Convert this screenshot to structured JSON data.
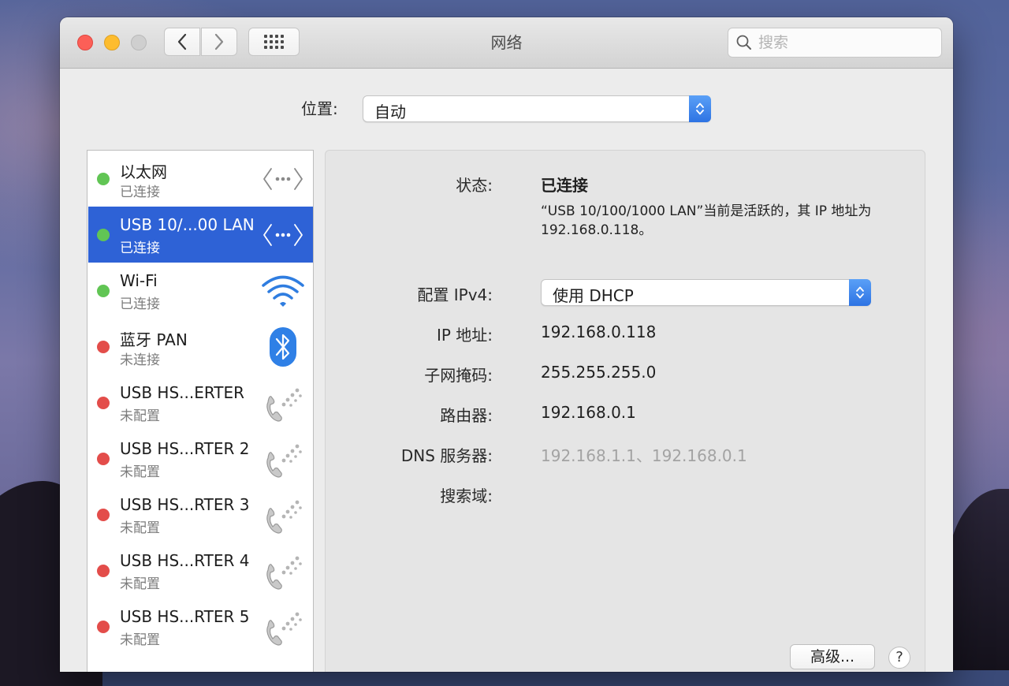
{
  "window": {
    "title": "网络"
  },
  "search": {
    "placeholder": "搜索"
  },
  "location": {
    "label": "位置:",
    "value": "自动"
  },
  "services": [
    {
      "name": "以太网",
      "status": "已连接",
      "state": "green",
      "icon": "ethernet-icon"
    },
    {
      "name": "USB 10/...00 LAN",
      "status": "已连接",
      "state": "green",
      "icon": "ethernet-icon"
    },
    {
      "name": "Wi-Fi",
      "status": "已连接",
      "state": "green",
      "icon": "wifi-icon"
    },
    {
      "name": "蓝牙 PAN",
      "status": "未连接",
      "state": "red",
      "icon": "bluetooth-icon"
    },
    {
      "name": "USB HS...ERTER",
      "status": "未配置",
      "state": "red",
      "icon": "phone-icon"
    },
    {
      "name": "USB HS...RTER 2",
      "status": "未配置",
      "state": "red",
      "icon": "phone-icon"
    },
    {
      "name": "USB HS...RTER 3",
      "status": "未配置",
      "state": "red",
      "icon": "phone-icon"
    },
    {
      "name": "USB HS...RTER 4",
      "status": "未配置",
      "state": "red",
      "icon": "phone-icon"
    },
    {
      "name": "USB HS...RTER 5",
      "status": "未配置",
      "state": "red",
      "icon": "phone-icon"
    }
  ],
  "selected_service": 1,
  "detail": {
    "status_label": "状态:",
    "status_value": "已连接",
    "status_desc": "“USB 10/100/1000 LAN”当前是活跃的，其 IP 地址为 192.168.0.118。",
    "ipv4_label": "配置 IPv4:",
    "ipv4_value": "使用 DHCP",
    "ip_label": "IP 地址:",
    "ip_value": "192.168.0.118",
    "subnet_label": "子网掩码:",
    "subnet_value": "255.255.255.0",
    "router_label": "路由器:",
    "router_value": "192.168.0.1",
    "dns_label": "DNS 服务器:",
    "dns_value": "192.168.1.1、192.168.0.1",
    "search_domain_label": "搜索域:"
  },
  "buttons": {
    "advanced": "高级...",
    "help": "?"
  },
  "colors": {
    "selection": "#2e62d6",
    "connected": "#61c554",
    "disconnected": "#e34d4a",
    "accent": "#2d73e3"
  }
}
